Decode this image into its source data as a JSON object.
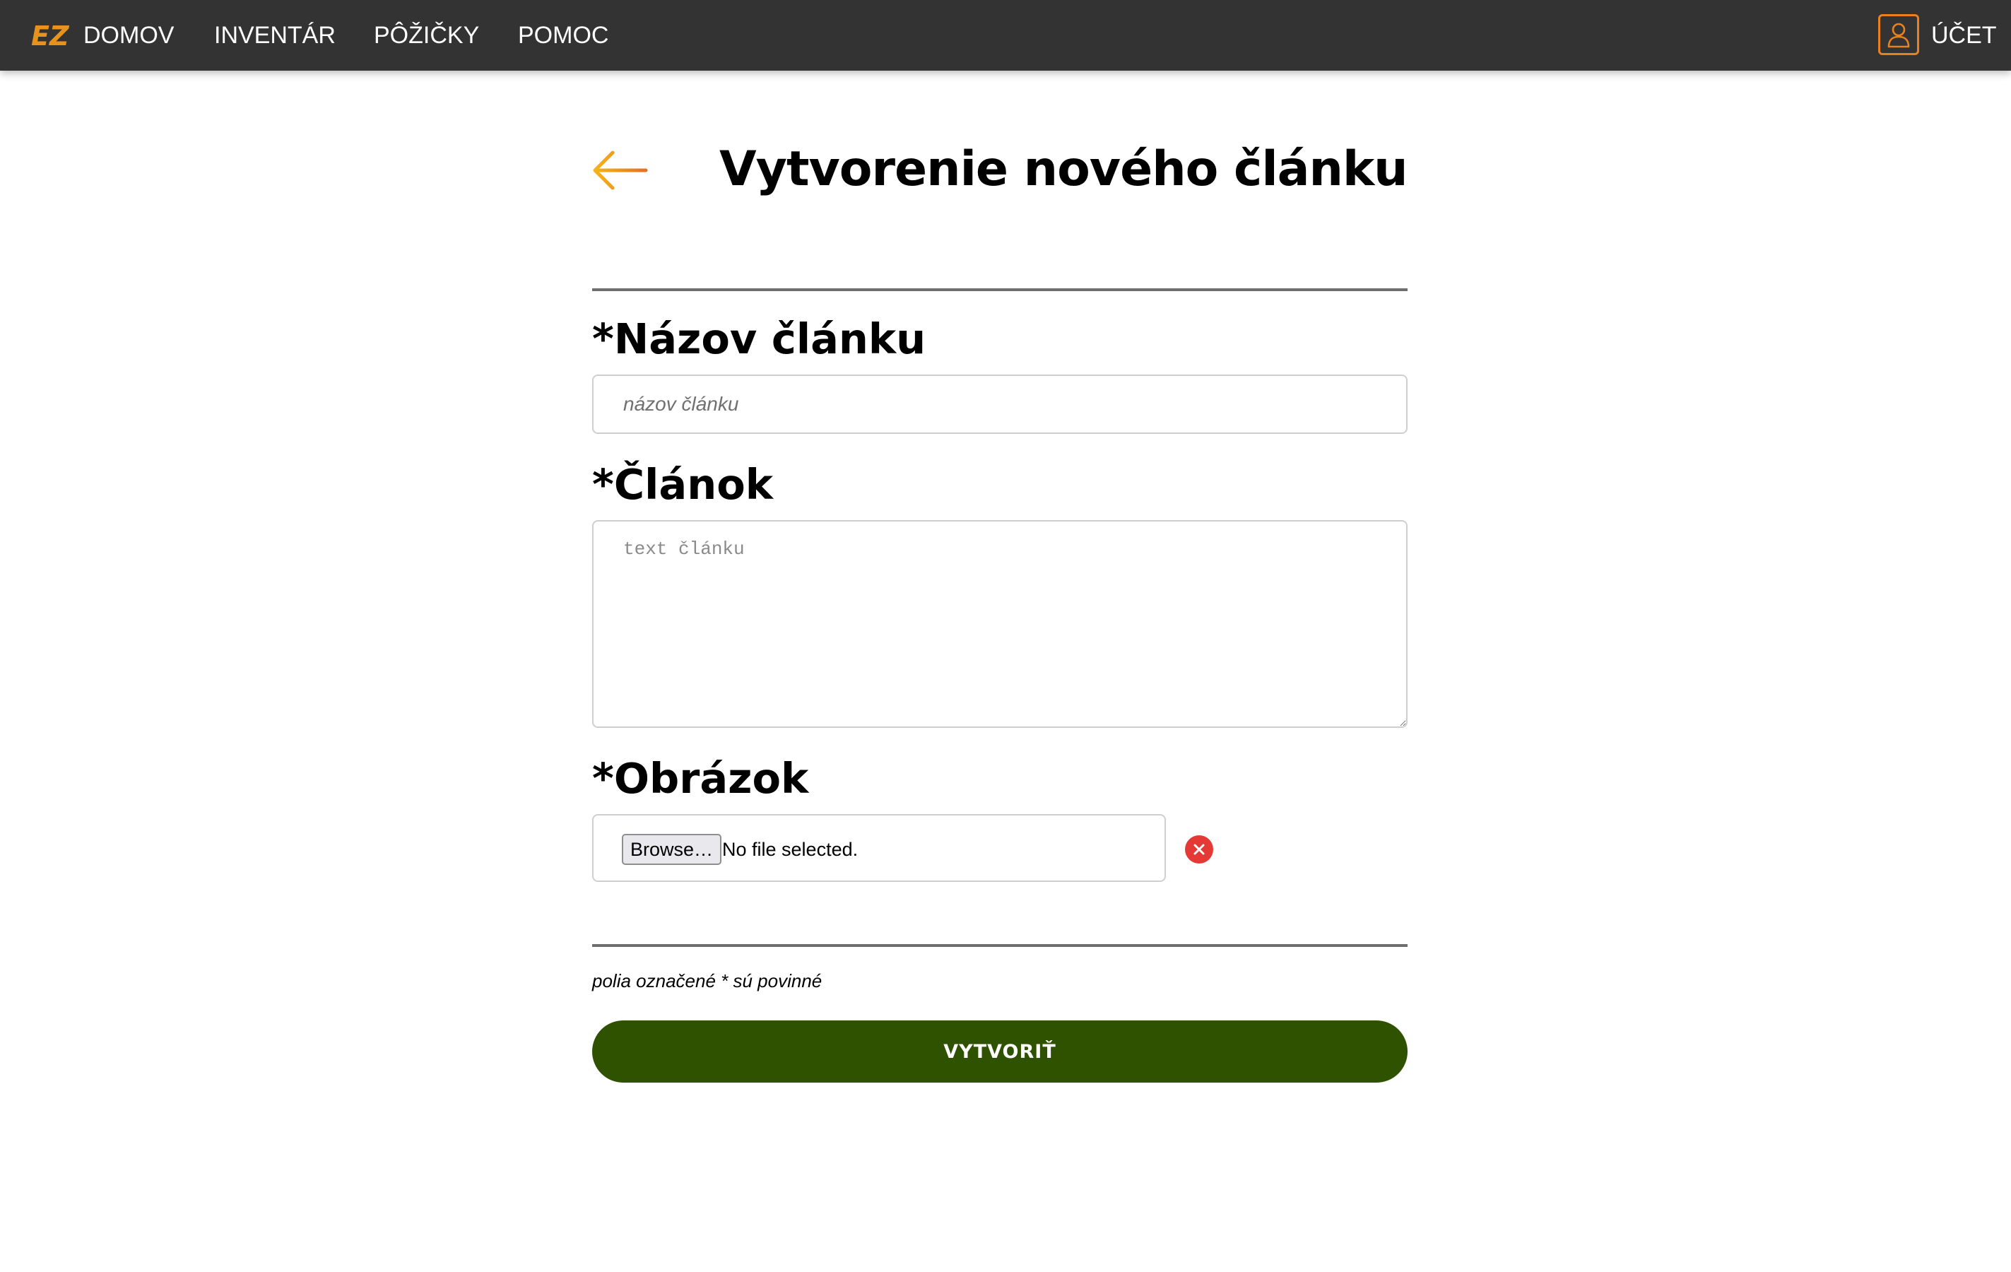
{
  "navbar": {
    "logo_text": "EZ",
    "items": [
      {
        "label": "DOMOV"
      },
      {
        "label": "INVENTÁR"
      },
      {
        "label": "PÔŽIČKY"
      },
      {
        "label": "POMOC"
      }
    ],
    "account_label": "ÚČET"
  },
  "header": {
    "title": "Vytvorenie nového článku"
  },
  "form": {
    "title_label": "*Názov článku",
    "title_placeholder": "názov článku",
    "title_value": "",
    "article_label": "*Článok",
    "article_placeholder": "text článku",
    "article_value": "",
    "image_label": "*Obrázok",
    "browse_label": "Browse…",
    "file_status": "No file selected.",
    "required_note": "polia označené * sú povinné",
    "submit_label": "VYTVORIŤ"
  },
  "icons": {
    "logo": "ez-logo",
    "account": "user-icon",
    "back": "arrow-left-icon",
    "clear": "close-circle-icon"
  },
  "colors": {
    "navbar_bg": "#333333",
    "accent": "#e8821e",
    "submit_bg": "#2e5200",
    "clear_bg": "#e53935"
  }
}
